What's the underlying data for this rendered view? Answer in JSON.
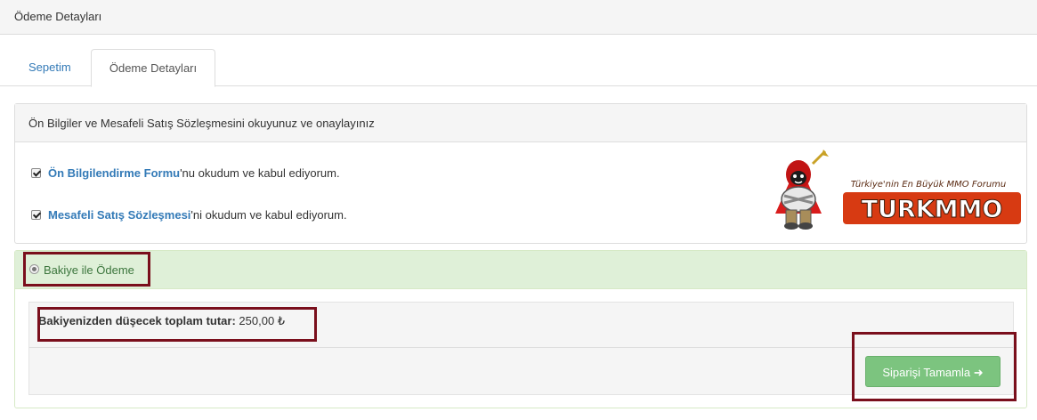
{
  "page": {
    "title": "Ödeme Detayları"
  },
  "tabs": [
    {
      "label": "Sepetim",
      "active": false
    },
    {
      "label": "Ödeme Detayları",
      "active": true
    }
  ],
  "agreement_panel": {
    "heading": "Ön Bilgiler ve Mesafeli Satış Sözleşmesini okuyunuz ve onaylayınız",
    "checkbox1": {
      "checked": true,
      "link": "Ön Bilgilendirme Formu",
      "text": "'nu okudum ve kabul ediyorum."
    },
    "checkbox2": {
      "checked": true,
      "link": "Mesafeli Satış Sözleşmesi",
      "text": "'ni okudum ve kabul ediyorum."
    },
    "logo": {
      "tagline": "Türkiye'nin En Büyük MMO Forumu",
      "brand": "TURKMMO"
    }
  },
  "payment_panel": {
    "option_label": "Bakiye ile Ödeme",
    "amount_label": "Bakiyenizden düşecek toplam tutar:",
    "amount_value": "250,00 ₺",
    "submit_label": "Siparişi Tamamla ➜"
  },
  "colors": {
    "link": "#337ab7",
    "success_bg": "#dff0d8",
    "button": "#7cc47f",
    "highlight": "#7a0f1c"
  }
}
